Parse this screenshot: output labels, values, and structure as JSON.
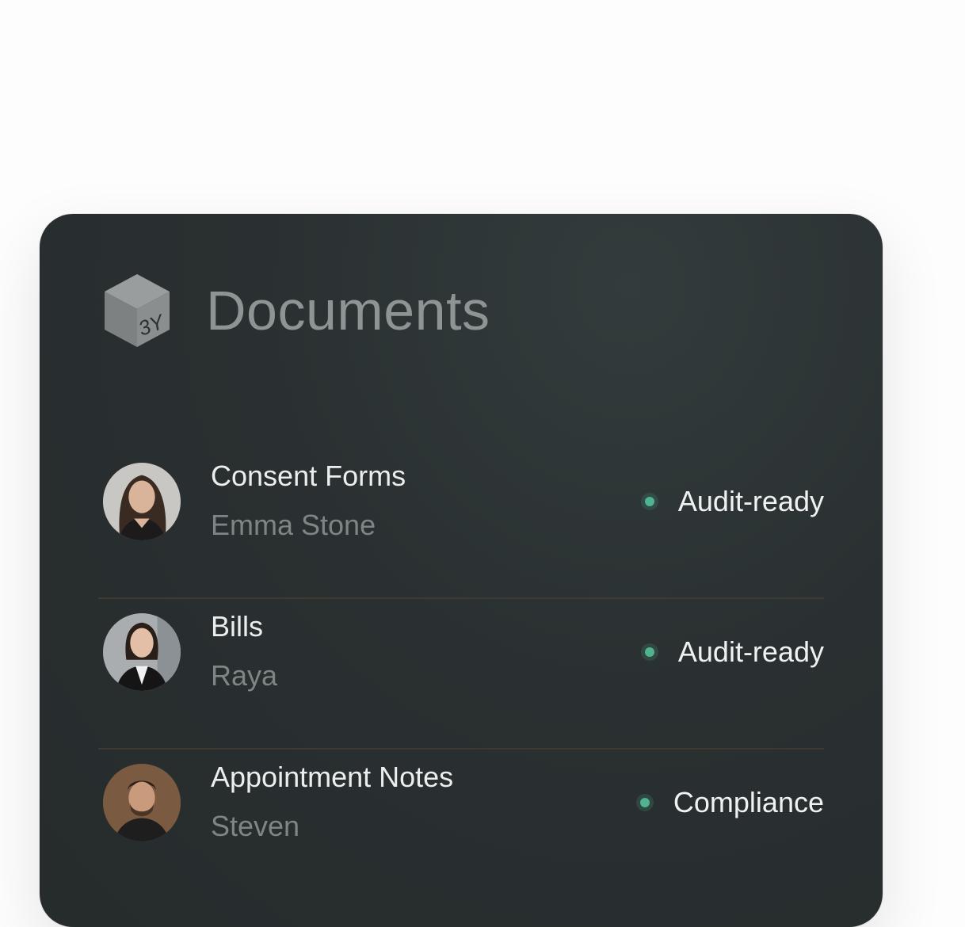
{
  "header": {
    "title": "Documents",
    "logo_text": "3Y",
    "logo_icon": "cube-logo-icon"
  },
  "documents": [
    {
      "title": "Consent Forms",
      "owner": "Emma Stone",
      "status": "Audit-ready"
    },
    {
      "title": "Bills",
      "owner": "Raya",
      "status": "Audit-ready"
    },
    {
      "title": "Appointment Notes",
      "owner": "Steven",
      "status": "Compliance"
    }
  ],
  "colors": {
    "card_background": "#2a3031",
    "status_dot": "#4fb38f",
    "divider": "#3d3a33"
  }
}
